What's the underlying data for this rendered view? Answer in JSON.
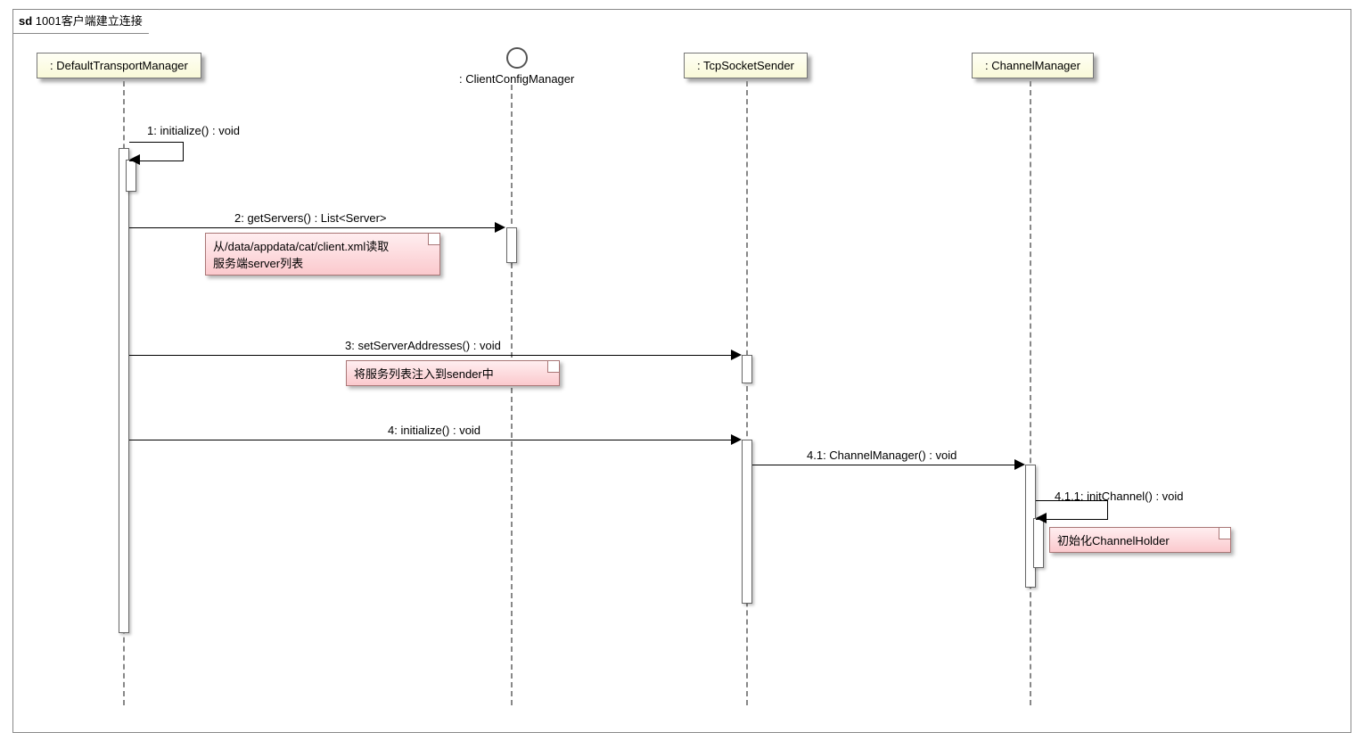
{
  "frame": {
    "prefix": "sd",
    "title": "1001客户端建立连接"
  },
  "lifelines": {
    "l1": ": DefaultTransportManager",
    "l2": ": ClientConfigManager",
    "l3": ": TcpSocketSender",
    "l4": ": ChannelManager"
  },
  "messages": {
    "m1": "1: initialize() : void",
    "m2": "2: getServers() : List<Server>",
    "m3": "3: setServerAddresses() : void",
    "m4": "4: initialize() : void",
    "m41": "4.1: ChannelManager() : void",
    "m411": "4.1.1: initChannel() : void"
  },
  "notes": {
    "n1a": "从/data/appdata/cat/client.xml读取",
    "n1b": "服务端server列表",
    "n2": "将服务列表注入到sender中",
    "n3": "初始化ChannelHolder"
  }
}
